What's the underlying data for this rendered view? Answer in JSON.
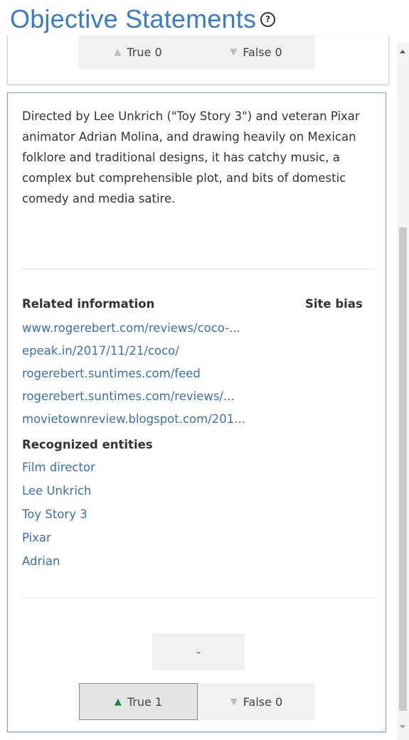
{
  "header": {
    "title": "Objective Statements",
    "help_icon": "?"
  },
  "top_card": {
    "true_label": "True 0",
    "false_label": "False 0"
  },
  "main_card": {
    "statement": "Directed by Lee Unkrich (\"Toy Story 3\") and veteran Pixar animator Adrian Molina, and drawing heavily on Mexican folklore and traditional designs, it has catchy music, a complex but comprehensible plot, and bits of domestic comedy and media satire.",
    "related_heading": "Related information",
    "site_bias_heading": "Site bias",
    "related_links": [
      "www.rogerebert.com/reviews/coco-...",
      "epeak.in/2017/11/21/coco/",
      "rogerebert.suntimes.com/feed",
      "rogerebert.suntimes.com/reviews/...",
      "movietownreview.blogspot.com/201..."
    ],
    "entities_heading": "Recognized entities",
    "entities": [
      "Film director",
      "Lee Unkrich",
      "Toy Story 3",
      "Pixar",
      "Adrian"
    ],
    "neutral_label": "-",
    "true_label": "True 1",
    "false_label": "False 0"
  },
  "colors": {
    "title": "#3a7bc8",
    "link": "#3a6fb0",
    "true_active": "#1e8a3c",
    "inactive_triangle": "#bdbdbd"
  },
  "icons": {
    "help": "help-circle-icon",
    "up": "triangle-up-icon",
    "down": "triangle-down-icon"
  }
}
